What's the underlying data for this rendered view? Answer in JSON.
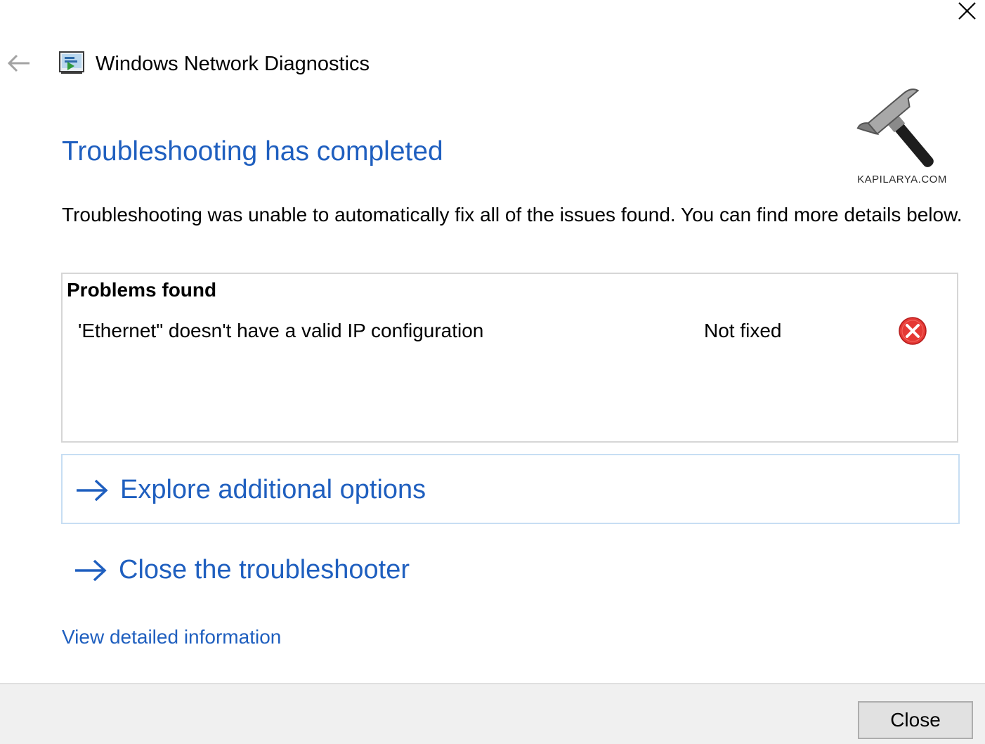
{
  "window": {
    "close_icon": "close-icon",
    "back_icon": "back-arrow-icon",
    "app_icon": "network-diagnostics-icon",
    "app_title": "Windows Network Diagnostics"
  },
  "watermark": {
    "icon": "hammer-icon",
    "text": "KAPILARYA.COM"
  },
  "main": {
    "heading": "Troubleshooting has completed",
    "description": "Troubleshooting was unable to automatically fix all of the issues found. You can find more details below.",
    "problems": {
      "title": "Problems found",
      "items": [
        {
          "name": "'Ethernet\" doesn't have a valid IP configuration",
          "status": "Not fixed",
          "status_icon": "error-icon"
        }
      ]
    },
    "options": [
      {
        "label": "Explore additional options",
        "icon": "arrow-right-icon"
      },
      {
        "label": "Close the troubleshooter",
        "icon": "arrow-right-icon"
      }
    ],
    "details_link": "View detailed information"
  },
  "footer": {
    "close_label": "Close"
  },
  "colors": {
    "accent": "#1f5fbf",
    "error": "#e53935",
    "footer_bg": "#f0f0f0",
    "option_border": "#c7def3"
  }
}
